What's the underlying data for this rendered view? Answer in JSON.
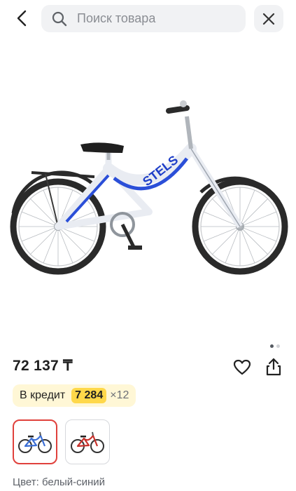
{
  "header": {
    "search_placeholder": "Поиск товара",
    "search_value": "",
    "back_icon": "chevron-left-icon",
    "search_icon": "search-icon",
    "close_icon": "close-icon"
  },
  "product": {
    "image_brand_text": "STELS",
    "price": "72 137 ₸",
    "gallery": {
      "total": 2,
      "active": 1
    },
    "credit": {
      "label": "В кредит",
      "amount": "7 284",
      "months": "×12"
    },
    "variants": [
      {
        "name": "белый-синий",
        "frame_color": "#3b6fd6",
        "selected": true
      },
      {
        "name": "красный",
        "frame_color": "#c8322c",
        "selected": false
      }
    ],
    "color_line": "Цвет: белый-синий"
  },
  "colors": {
    "accent_red": "#e0413c",
    "credit_bg": "#fff7d6",
    "credit_badge": "#ffd84a",
    "search_bg": "#f1f2f4"
  }
}
